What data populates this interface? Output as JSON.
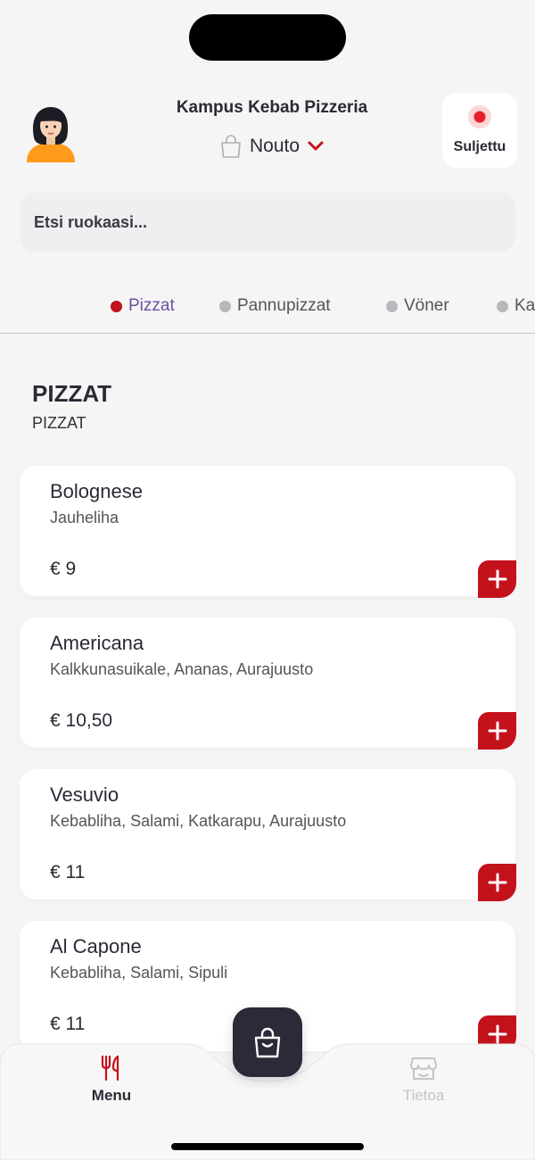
{
  "header": {
    "restaurant_name": "Kampus Kebab Pizzeria",
    "mode_label": "Nouto",
    "status_label": "Suljettu",
    "status_color": "#e8202a"
  },
  "search": {
    "placeholder": "Etsi ruokaasi..."
  },
  "categories": [
    {
      "label": "Pizzat",
      "active": true
    },
    {
      "label": "Pannupizzat",
      "active": false
    },
    {
      "label": "Vöner",
      "active": false
    },
    {
      "label": "Ka",
      "active": false
    }
  ],
  "section": {
    "title": "PIZZAT",
    "subtitle": "PIZZAT"
  },
  "items": [
    {
      "name": "Bolognese",
      "description": "Jauheliha",
      "price": "€ 9"
    },
    {
      "name": "Americana",
      "description": "Kalkkunasuikale, Ananas, Aurajuusto",
      "price": "€ 10,50"
    },
    {
      "name": "Vesuvio",
      "description": "Kebabliha, Salami, Katkarapu, Aurajuusto",
      "price": "€ 11"
    },
    {
      "name": "Al Capone",
      "description": "Kebabliha, Salami, Sipuli",
      "price": "€ 11"
    }
  ],
  "tabbar": {
    "menu_label": "Menu",
    "info_label": "Tietoa",
    "menu_icon": "fork-knife-icon",
    "info_icon": "store-icon",
    "cart_icon": "shopping-bag-icon"
  },
  "colors": {
    "accent": "#c4121c",
    "active_category_text": "#6a4fa0",
    "dark": "#2a2a38"
  }
}
